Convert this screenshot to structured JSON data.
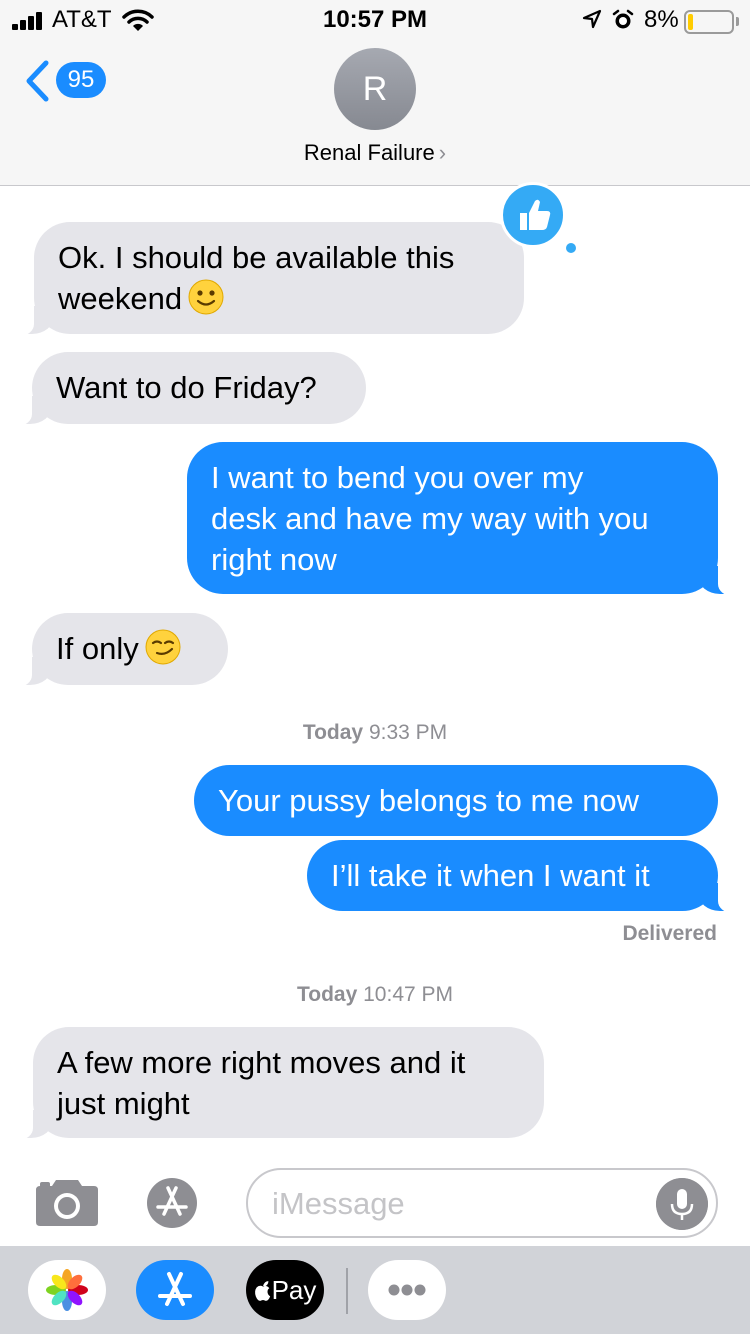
{
  "status_bar": {
    "carrier": "AT&T",
    "time": "10:57 PM",
    "battery_percent": "8%",
    "battery_level": 0.08,
    "icons": [
      "signal-icon",
      "wifi-icon",
      "location-icon",
      "alarm-icon",
      "battery-icon"
    ]
  },
  "header": {
    "back_count": "95",
    "avatar_initial": "R",
    "contact_name": "Renal Failure",
    "chevron": "›"
  },
  "messages": [
    {
      "direction": "incoming",
      "lines": [
        "Ok. I should be available this",
        "weekend"
      ],
      "emoji": "slightly-smiling-face",
      "tapback": "thumbs-up"
    },
    {
      "direction": "incoming",
      "text": "Want to do Friday?"
    },
    {
      "direction": "outgoing",
      "lines": [
        "I want to bend you over my",
        "desk and have my way with you",
        "right now"
      ]
    },
    {
      "direction": "incoming",
      "text": "If only",
      "emoji": "smirking-face"
    },
    {
      "direction": "outgoing",
      "text": "Your pussy belongs to me now"
    },
    {
      "direction": "outgoing",
      "text": "I’ll take it when I want it"
    },
    {
      "direction": "incoming",
      "lines": [
        "A few more right moves and it",
        "just might"
      ]
    }
  ],
  "timestamps": [
    {
      "day": "Today",
      "time": "9:33 PM"
    },
    {
      "day": "Today",
      "time": "10:47 PM"
    }
  ],
  "delivered_label": "Delivered",
  "compose": {
    "placeholder": "iMessage"
  },
  "drawer": {
    "pay_label": "Pay",
    "apps": [
      "photos-icon",
      "app-store-icon",
      "apple-pay-icon",
      "more-icon"
    ]
  },
  "colors": {
    "outgoing_bubble": "#1a8cff",
    "incoming_bubble": "#e5e5ea",
    "accent": "#1a8cff",
    "battery_low": "#ffcc00"
  }
}
